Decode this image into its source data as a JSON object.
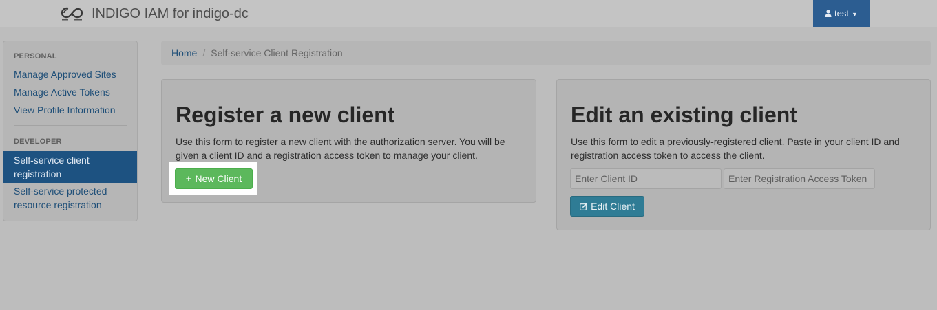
{
  "header": {
    "logo_icon": "indigo-infinity-logo",
    "title": "INDIGO IAM for indigo-dc",
    "user": {
      "icon": "user-icon",
      "name": "test",
      "caret_icon": "caret-down-icon"
    }
  },
  "sidebar": {
    "personal_header": "PERSONAL",
    "personal_items": [
      "Manage Approved Sites",
      "Manage Active Tokens",
      "View Profile Information"
    ],
    "developer_header": "DEVELOPER",
    "developer_active": "Self-service client registration",
    "developer_items": [
      "Self-service protected resource registration"
    ]
  },
  "breadcrumb": {
    "home": "Home",
    "separator": "/",
    "current": "Self-service Client Registration"
  },
  "register": {
    "title": "Register a new client",
    "description": "Use this form to register a new client with the authorization server. You will be given a client ID and a registration access token to manage your client.",
    "button_icon": "plus-icon",
    "button_label": "New Client"
  },
  "edit": {
    "title": "Edit an existing client",
    "description": "Use this form to edit a previously-registered client. Paste in your client ID and registration access token to access the client.",
    "client_id_placeholder": "Enter Client ID",
    "token_placeholder": "Enter Registration Access Token",
    "button_icon": "edit-icon",
    "button_label": "Edit Client"
  },
  "colors": {
    "nav_active": "#1d5281",
    "user_menu": "#2c5d91",
    "new_button": "#5cb85c",
    "edit_button": "#2f7c95"
  }
}
